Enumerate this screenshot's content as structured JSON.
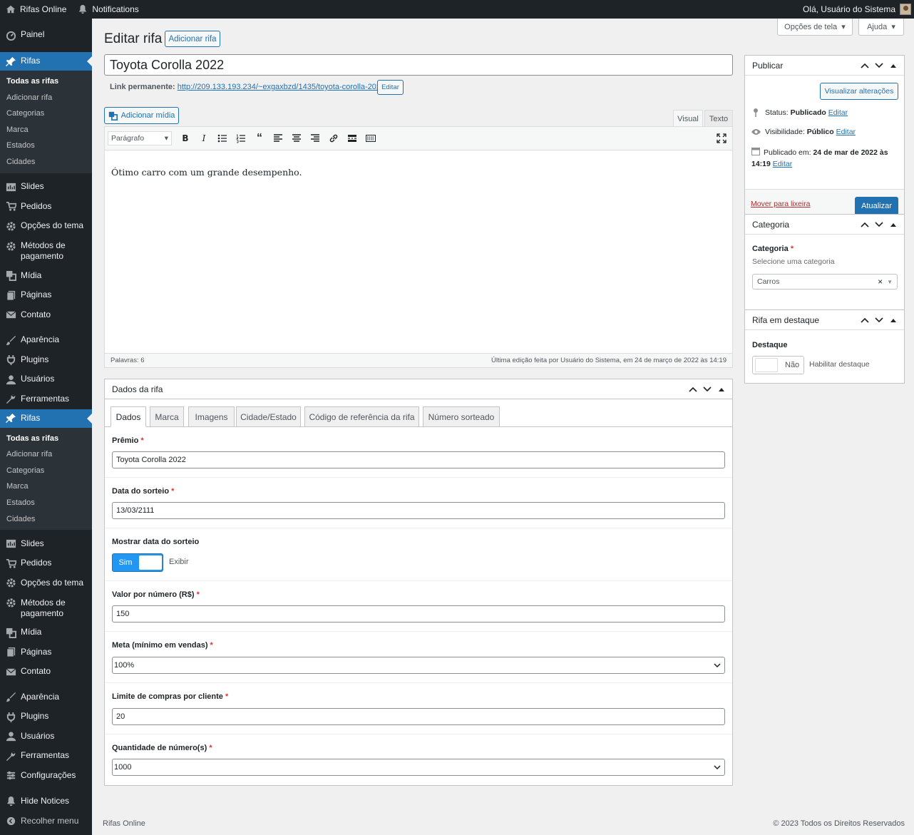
{
  "adminbar": {
    "site": "Rifas Online",
    "notifications": "Notifications",
    "greeting": "Olá, Usuário do Sistema"
  },
  "sidebar": {
    "top": [
      {
        "label": "Painel",
        "icon": "dashboard-icon"
      },
      {
        "label": "Rifas",
        "icon": "pin-icon",
        "active": true
      }
    ],
    "submenu1": [
      "Todas as rifas",
      "Adicionar rifa",
      "Categorias",
      "Marca",
      "Estados",
      "Cidades"
    ],
    "group1": [
      {
        "label": "Slides",
        "icon": "slides-icon"
      },
      {
        "label": "Pedidos",
        "icon": "cart-icon"
      },
      {
        "label": "Opções do tema",
        "icon": "gear-icon"
      },
      {
        "label": "Métodos de pagamento",
        "icon": "gear-icon"
      },
      {
        "label": "Mídia",
        "icon": "media-icon"
      },
      {
        "label": "Páginas",
        "icon": "pages-icon"
      },
      {
        "label": "Contato",
        "icon": "mail-icon"
      }
    ],
    "group2": [
      {
        "label": "Aparência",
        "icon": "brush-icon"
      },
      {
        "label": "Plugins",
        "icon": "plugin-icon"
      },
      {
        "label": "Usuários",
        "icon": "user-icon"
      },
      {
        "label": "Ferramentas",
        "icon": "wrench-icon"
      }
    ],
    "rifas2": "Rifas",
    "submenu2": [
      "Todas as rifas",
      "Adicionar rifa",
      "Categorias",
      "Marca",
      "Estados",
      "Cidades"
    ],
    "group3": [
      {
        "label": "Slides",
        "icon": "slides-icon"
      },
      {
        "label": "Pedidos",
        "icon": "cart-icon"
      },
      {
        "label": "Opções do tema",
        "icon": "gear-icon"
      },
      {
        "label": "Métodos de pagamento",
        "icon": "gear-icon"
      },
      {
        "label": "Mídia",
        "icon": "media-icon"
      },
      {
        "label": "Páginas",
        "icon": "pages-icon"
      },
      {
        "label": "Contato",
        "icon": "mail-icon"
      }
    ],
    "group4": [
      {
        "label": "Aparência",
        "icon": "brush-icon"
      },
      {
        "label": "Plugins",
        "icon": "plugin-icon"
      },
      {
        "label": "Usuários",
        "icon": "user-icon"
      },
      {
        "label": "Ferramentas",
        "icon": "wrench-icon"
      },
      {
        "label": "Configurações",
        "icon": "settings-icon"
      }
    ],
    "hide_notices": "Hide Notices",
    "collapse": "Recolher menu"
  },
  "screen": {
    "options": "Opções de tela",
    "help": "Ajuda"
  },
  "page": {
    "title": "Editar rifa",
    "add_new": "Adicionar rifa"
  },
  "post": {
    "title": "Toyota Corolla 2022",
    "permalink_label": "Link permanente:",
    "permalink_url": "http://209.133.193.234/~exgaxbzd/1435/toyota-corolla-2022/",
    "edit_link": "Editar",
    "add_media": "Adicionar mídia",
    "tab_visual": "Visual",
    "tab_text": "Texto",
    "format": "Parágrafo",
    "content": "Ótimo carro com um grande desempenho.",
    "word_count": "Palavras: 6",
    "last_edit": "Última edição feita por Usuário do Sistema, em 24 de março de 2022 às 14:19"
  },
  "dados": {
    "title": "Dados da rifa",
    "tabs": [
      "Dados",
      "Marca",
      "Imagens",
      "Cidade/Estado",
      "Código de referência da rifa",
      "Número sorteado"
    ],
    "premio_label": "Prêmio",
    "premio": "Toyota Corolla 2022",
    "data_label": "Data do sorteio",
    "data": "13/03/2111",
    "mostrar_label": "Mostrar data do sorteio",
    "toggle_on": "Sim",
    "exibir": "Exibir",
    "valor_label": "Valor por número (R$)",
    "valor": "150",
    "meta_label": "Meta (mínimo em vendas)",
    "meta": "100%",
    "limite_label": "Limite de compras por cliente",
    "limite": "20",
    "qtd_label": "Quantidade de número(s)",
    "qtd": "1000",
    "required": "*"
  },
  "publish": {
    "title": "Publicar",
    "preview": "Visualizar alterações",
    "status_label": "Status:",
    "status": "Publicado",
    "status_edit": "Editar",
    "vis_label": "Visibilidade:",
    "vis": "Público",
    "vis_edit": "Editar",
    "pub_label": "Publicado em:",
    "pub_date": "24 de mar de 2022 às",
    "pub_time": "14:19",
    "pub_edit": "Editar",
    "trash": "Mover para lixeira",
    "update": "Atualizar"
  },
  "categoria": {
    "title": "Categoria",
    "label": "Categoria",
    "required": "*",
    "desc": "Selecione uma categoria",
    "value": "Carros",
    "clear": "×"
  },
  "destaque": {
    "title": "Rifa em destaque",
    "label": "Destaque",
    "toggle_off": "Não",
    "desc": "Habilitar destaque"
  },
  "footer": {
    "left": "Rifas Online",
    "right": "© 2023 Todos os Direitos Reservados"
  }
}
